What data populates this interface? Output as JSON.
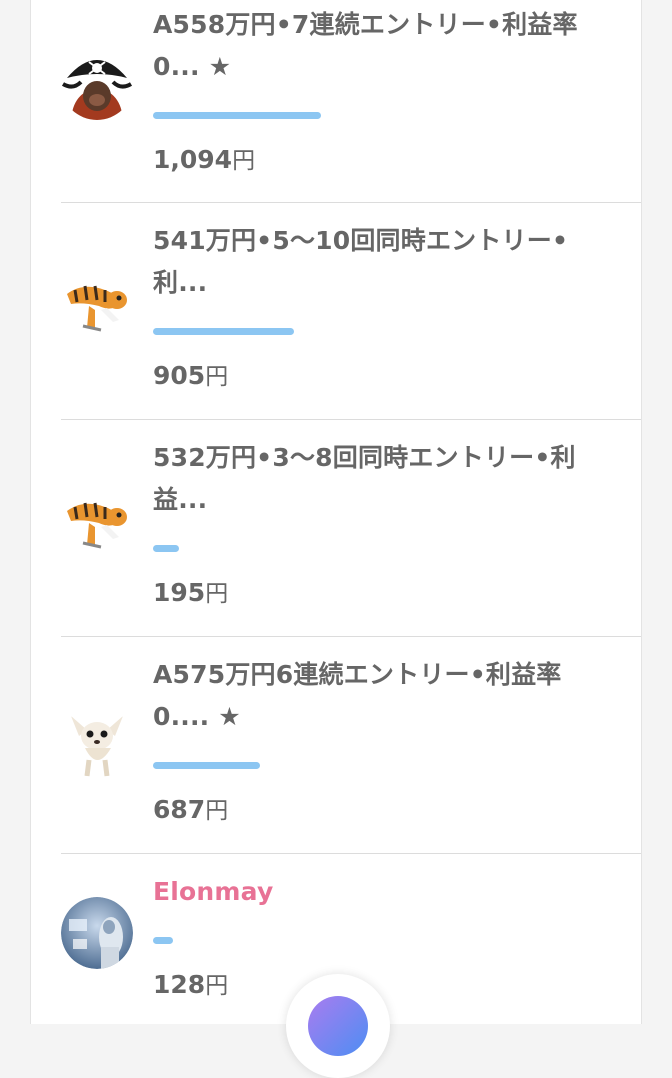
{
  "items": [
    {
      "title": "A558万円•7連続エントリー•利益率0... ★",
      "progress": 0.3,
      "amount": "1,094",
      "currency": "円",
      "avatar": "pirate-icon"
    },
    {
      "title": "541万円•5〜10回同時エントリー•利...",
      "progress": 0.24,
      "amount": "905",
      "currency": "円",
      "avatar": "tiger-icon"
    },
    {
      "title": "532万円•3〜8回同時エントリー•利益...",
      "progress": 0.05,
      "amount": "195",
      "currency": "円",
      "avatar": "tiger-icon"
    },
    {
      "title": "A575万円6連続エントリー•利益率0.... ★",
      "progress": 0.22,
      "amount": "687",
      "currency": "円",
      "avatar": "chihuahua-icon"
    },
    {
      "title": "Elonmay",
      "progress": 0.04,
      "amount": "128",
      "currency": "円",
      "avatar": "robot-icon",
      "title_color": "#e87295"
    }
  ],
  "colors": {
    "bar": "#8cc6f2",
    "text": "#666666",
    "highlight_name": "#e87295"
  }
}
